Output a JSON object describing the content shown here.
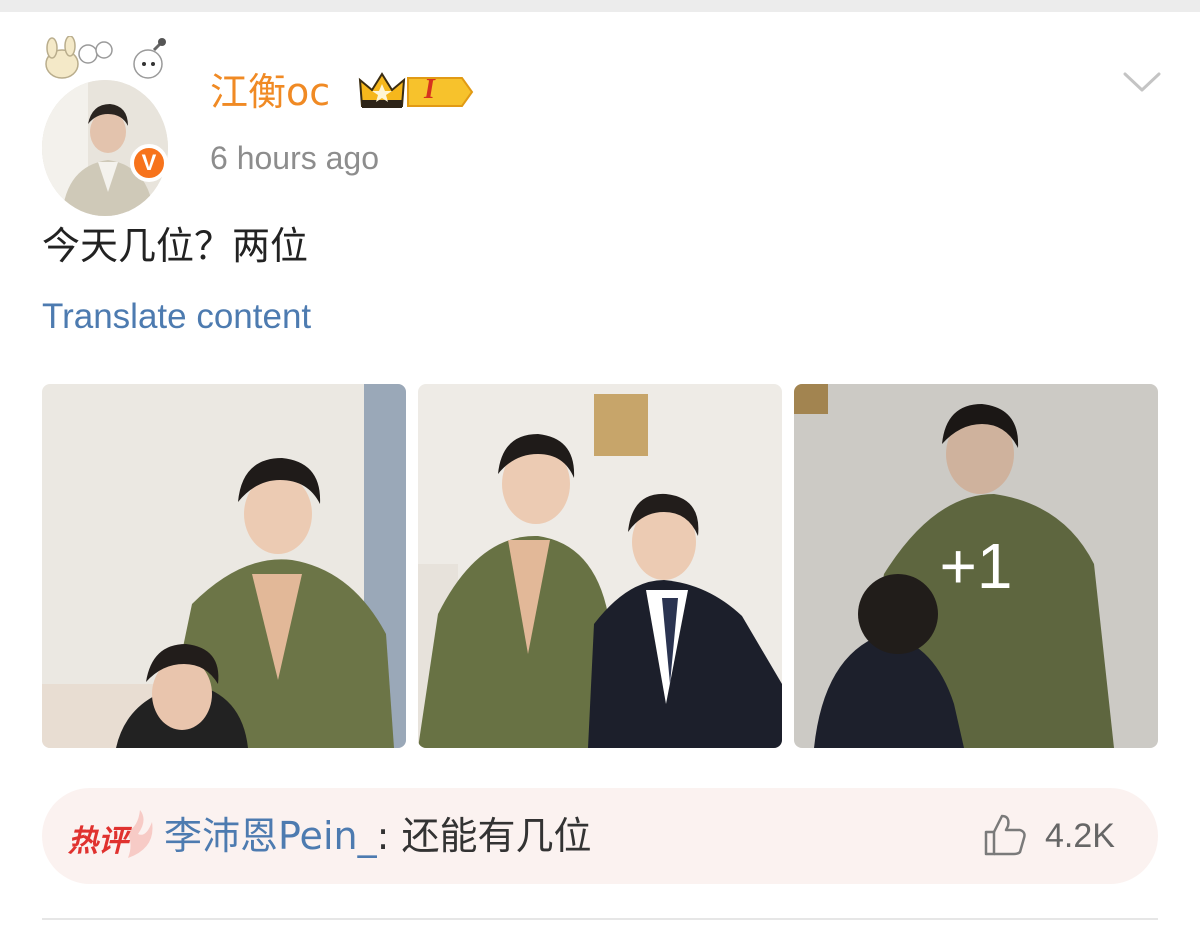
{
  "post": {
    "username": "江衡oc",
    "vip_level": "I",
    "timestamp": "6 hours ago",
    "verified_mark": "V",
    "text": "今天几位？两位",
    "translate_label": "Translate content",
    "more_photos": "+1"
  },
  "hot_comment": {
    "label": "热评",
    "commenter": "李沛恩Pein_",
    "separator": ": ",
    "text": "还能有几位",
    "likes": "4.2K"
  },
  "icons": {
    "verified": "verified-v-icon",
    "vip": "crown-vip-icon",
    "more": "chevron-down-icon",
    "like": "thumbs-up-icon"
  },
  "colors": {
    "username": "#f08a24",
    "link": "#4d7bb0",
    "timestamp": "#8d8d8d",
    "hot_label": "#e0322f",
    "hot_bg": "#fbf2f0",
    "verified": "#f7731c"
  }
}
